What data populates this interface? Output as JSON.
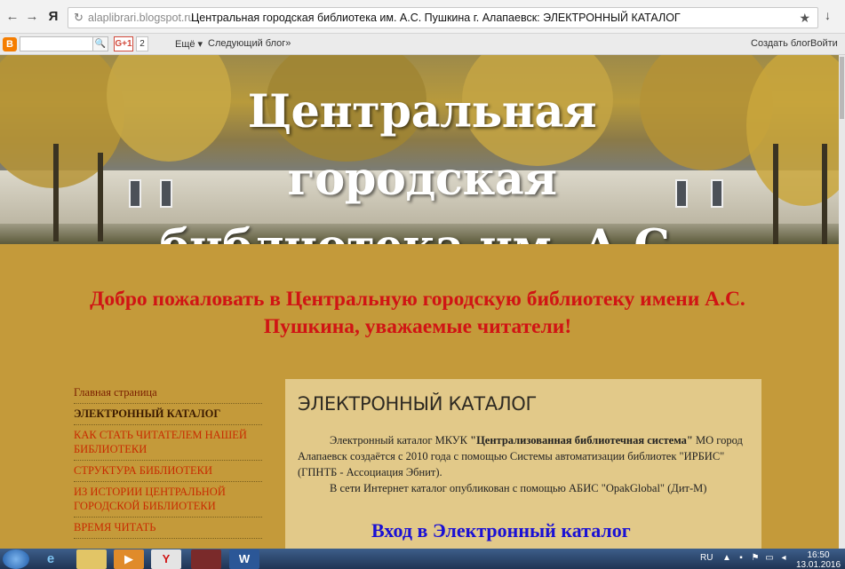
{
  "browser": {
    "url_domain": "alaplibrari.blogspot.ru",
    "page_title": "Центральная городская библиотека им. А.С. Пушкина г. Алапаевск: ЭЛЕКТРОННЫЙ КАТАЛОГ",
    "back_glyph": "←",
    "forward_glyph": "→",
    "yandex_glyph": "Я",
    "reload_glyph": "↻",
    "star_glyph": "★",
    "download_glyph": "↓"
  },
  "navbar": {
    "logo_letter": "B",
    "gplus_label": "G+1",
    "gplus_count": "2",
    "more_label": "Ещё ▾",
    "next_blog_label": "Следующий блог»",
    "create_blog_label": "Создать блог",
    "sign_in_label": "Войти"
  },
  "header": {
    "site_title": "Центральная городская библиотека им. А.С. Пушкина г. Алапаевск"
  },
  "welcome_text": "Добро пожаловать в Центральную городскую библиотеку имени А.С. Пушкина, уважаемые читатели!",
  "sidebar": {
    "items": [
      {
        "label": "Главная страница"
      },
      {
        "label": "ЭЛЕКТРОННЫЙ КАТАЛОГ"
      },
      {
        "label": "КАК СТАТЬ ЧИТАТЕЛЕМ НАШЕЙ БИБЛИОТЕКИ"
      },
      {
        "label": "СТРУКТУРА БИБЛИОТЕКИ"
      },
      {
        "label": "ИЗ ИСТОРИИ ЦЕНТРАЛЬНОЙ ГОРОДСКОЙ БИБЛИОТЕКИ"
      },
      {
        "label": "ВРЕМЯ ЧИТАТЬ"
      }
    ]
  },
  "post": {
    "title": "ЭЛЕКТРОННЫЙ КАТАЛОГ",
    "para1_prefix": "Электронный каталог МКУК ",
    "para1_bold": "\"Централизованная библиотечная система\"",
    "para1_suffix": " МО город Алапаевск создаётся  с 2010 года с помощью Системы автоматизации библиотек \"ИРБИС\" (ГПНТБ - Ассоциация Эбнит).",
    "para2": "В сети Интернет каталог опубликован с помощью АБИС  \"OpakGlobal\" (Дит-М)",
    "catalog_link": "Вход в Электронный каталог"
  },
  "taskbar": {
    "lang": "RU",
    "time": "16:50",
    "date": "13.01.2016"
  },
  "colors": {
    "page_bg": "#c49a3a",
    "welcome_text": "#d01414",
    "sidebar_link": "#c82b00",
    "post_bg": "#e2c989",
    "catalog_link": "#1a10d4"
  }
}
